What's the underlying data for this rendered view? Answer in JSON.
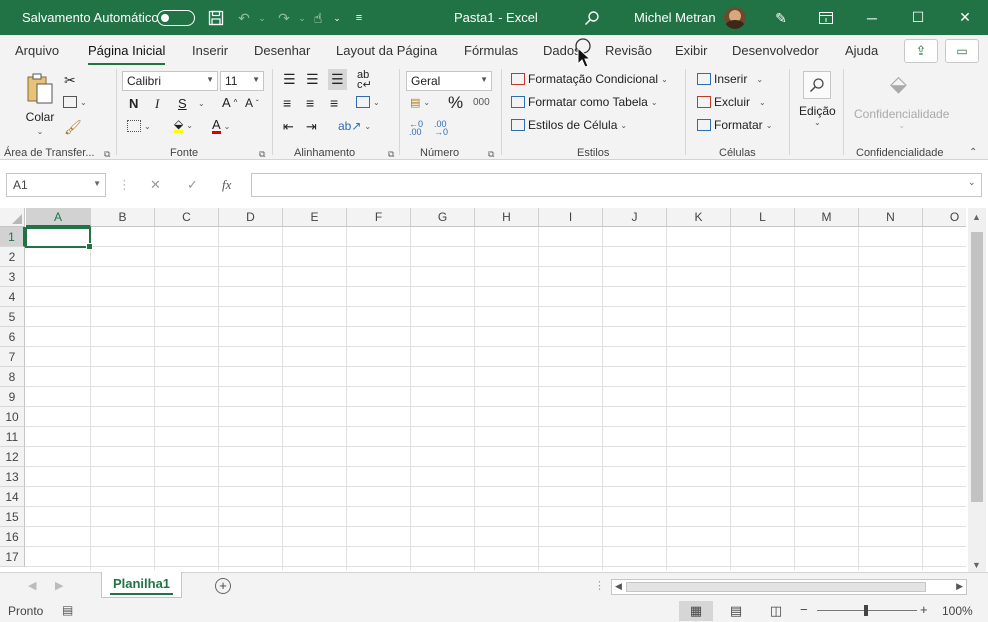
{
  "titlebar": {
    "autosave_label": "Salvamento Automático",
    "title": "Pasta1  -  Excel",
    "user": "Michel Metran"
  },
  "tabs": [
    "Arquivo",
    "Página Inicial",
    "Inserir",
    "Desenhar",
    "Layout da Página",
    "Fórmulas",
    "Dados",
    "Revisão",
    "Exibir",
    "Desenvolvedor",
    "Ajuda"
  ],
  "ribbon": {
    "clipboard": {
      "paste_label": "Colar",
      "group_label": "Área de Transfer..."
    },
    "font": {
      "font_name": "Calibri",
      "font_size": "11",
      "bold": "N",
      "italic": "I",
      "underline": "S",
      "grow": "A",
      "shrink": "A",
      "group_label": "Fonte"
    },
    "alignment": {
      "group_label": "Alinhamento"
    },
    "number": {
      "format": "Geral",
      "group_label": "Número"
    },
    "styles": {
      "cond_format": "Formatação Condicional",
      "format_table": "Formatar como Tabela",
      "cell_styles": "Estilos de Célula",
      "group_label": "Estilos"
    },
    "cells": {
      "insert": "Inserir",
      "delete": "Excluir",
      "format": "Formatar",
      "group_label": "Células"
    },
    "editing": {
      "label": "Edição"
    },
    "sensitivity": {
      "label": "Confidencialidade",
      "group_label": "Confidencialidade"
    }
  },
  "formula_bar": {
    "name_box": "A1",
    "fx": "fx",
    "content": ""
  },
  "grid": {
    "columns": [
      "A",
      "B",
      "C",
      "D",
      "E",
      "F",
      "G",
      "H",
      "I",
      "J",
      "K",
      "L",
      "M",
      "N",
      "O"
    ],
    "rows": [
      "1",
      "2",
      "3",
      "4",
      "5",
      "6",
      "7",
      "8",
      "9",
      "10",
      "11",
      "12",
      "13",
      "14",
      "15",
      "16",
      "17"
    ],
    "active_cell": "A1"
  },
  "sheets": {
    "active": "Planilha1"
  },
  "status": {
    "mode": "Pronto",
    "zoom": "100%"
  },
  "colors": {
    "accent": "#217346"
  }
}
